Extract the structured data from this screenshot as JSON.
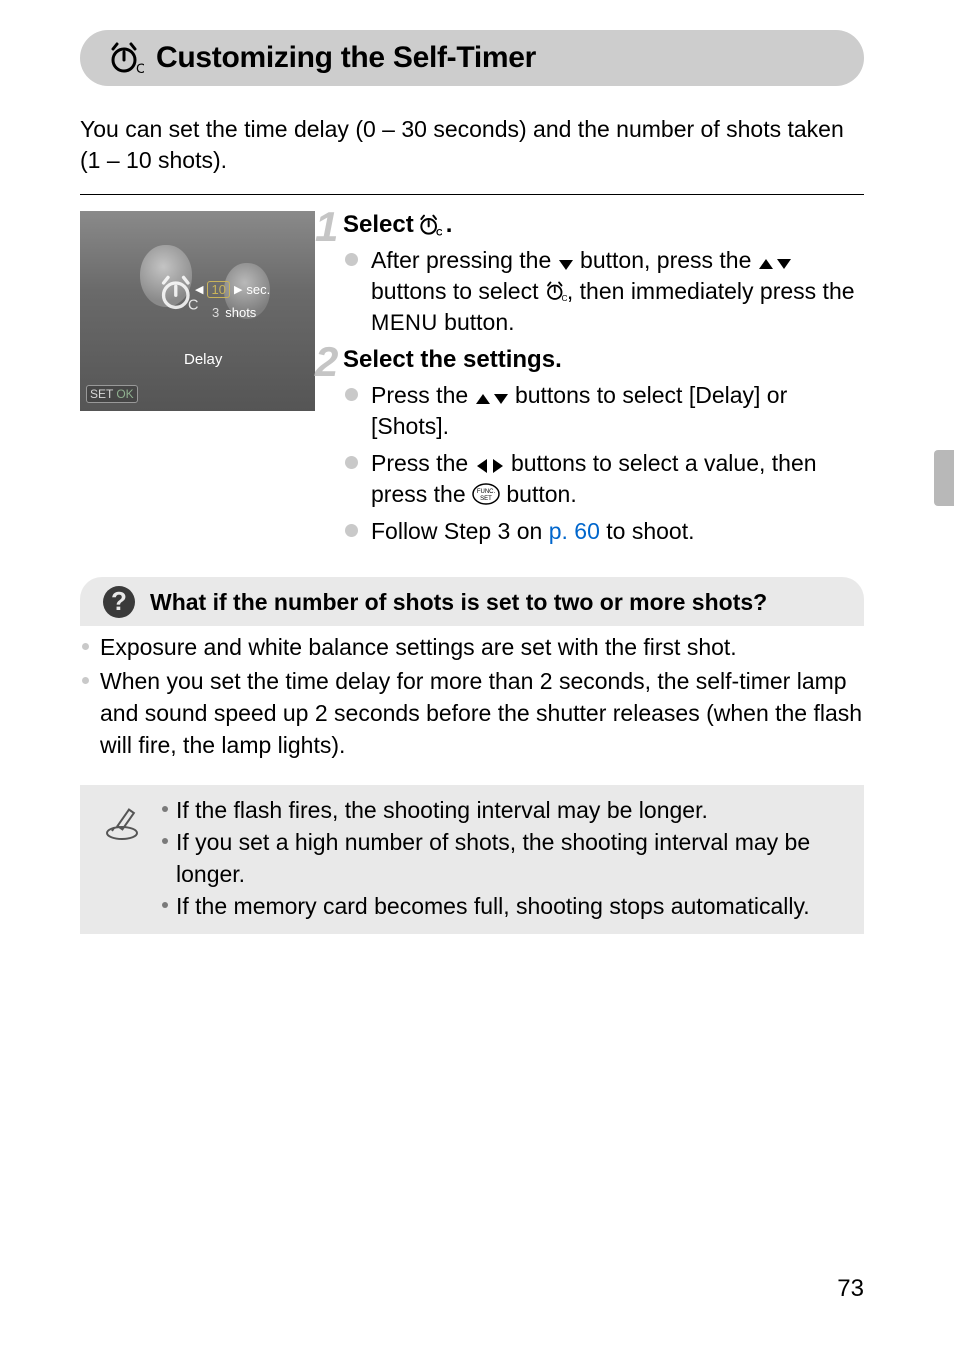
{
  "title": "Customizing the Self-Timer",
  "intro": "You can set the time delay (0 – 30 seconds) and the number of shots taken (1 – 10 shots).",
  "screenshot": {
    "sec_value": "10",
    "sec_label": "sec.",
    "shots_value": "3",
    "shots_label": "shots",
    "delay_label": "Delay",
    "set_label": "SET",
    "ok_label": "OK"
  },
  "step1": {
    "num": "1",
    "title_prefix": "Select ",
    "title_suffix": ".",
    "bullet1_a": "After pressing the ",
    "bullet1_b": " button, press the ",
    "bullet1_c": " buttons to select ",
    "bullet1_d": ", then immediately press the ",
    "bullet1_menu": "MENU",
    "bullet1_e": " button."
  },
  "step2": {
    "num": "2",
    "title": "Select the settings.",
    "bullet1_a": "Press the ",
    "bullet1_b": " buttons to select [Delay] or [Shots].",
    "bullet2_a": "Press the ",
    "bullet2_b": " buttons to select a value, then press the ",
    "bullet2_c": " button.",
    "bullet3_a": "Follow Step 3 on ",
    "bullet3_link": "p. 60",
    "bullet3_b": " to shoot."
  },
  "faq": {
    "title": "What if the number of shots is set to two or more shots?",
    "item1": "Exposure and white balance settings are set with the first shot.",
    "item2": "When you set the time delay for more than 2 seconds, the self-timer lamp and sound speed up 2 seconds before the shutter releases (when the flash will fire, the lamp lights)."
  },
  "notes": {
    "item1": "If the flash fires, the shooting interval may be longer.",
    "item2": "If you set a high number of shots, the shooting interval may be longer.",
    "item3": "If the memory card becomes full, shooting stops automatically."
  },
  "page_number": "73"
}
